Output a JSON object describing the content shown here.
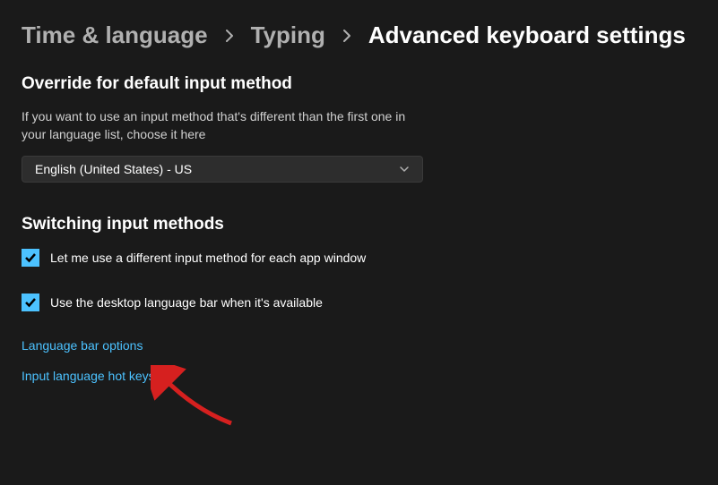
{
  "breadcrumb": {
    "items": [
      {
        "label": "Time & language"
      },
      {
        "label": "Typing"
      },
      {
        "label": "Advanced keyboard settings"
      }
    ]
  },
  "override": {
    "title": "Override for default input method",
    "desc": "If you want to use an input method that's different than the first one in your language list, choose it here",
    "selected": "English (United States) - US"
  },
  "switching": {
    "title": "Switching input methods",
    "checkbox1_label": "Let me use a different input method for each app window",
    "checkbox2_label": "Use the desktop language bar when it's available",
    "link1": "Language bar options",
    "link2": "Input language hot keys"
  }
}
